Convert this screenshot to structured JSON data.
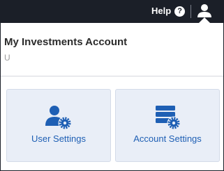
{
  "topbar": {
    "help_label": "Help",
    "help_icon_glyph": "?",
    "user_icon": "user-icon"
  },
  "account": {
    "title": "My Investments Account",
    "subtitle": "U"
  },
  "tiles": [
    {
      "label": "User Settings",
      "icon": "user-settings-icon"
    },
    {
      "label": "Account Settings",
      "icon": "account-settings-icon"
    }
  ],
  "colors": {
    "topbar_bg": "#1b1f28",
    "tile_bg": "#e9eef7",
    "accent_blue": "#1e5fb4",
    "title_text": "#2b2b2b",
    "muted_text": "#9a9a9a"
  }
}
